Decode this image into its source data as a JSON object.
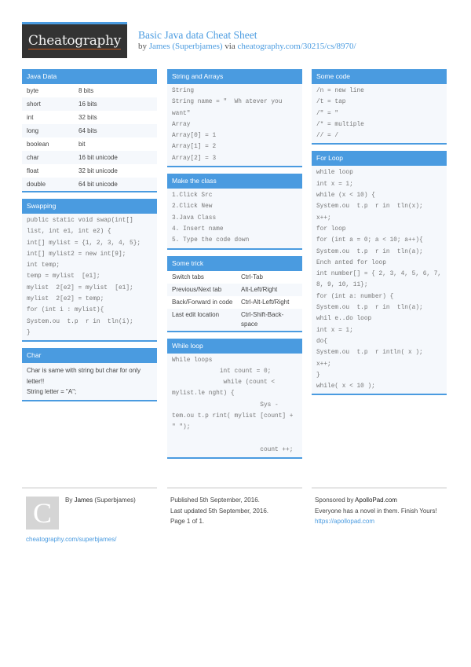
{
  "header": {
    "logo_text": "Cheatography",
    "title": "Basic Java data Cheat Sheet",
    "by_prefix": "by ",
    "author": "James (Superbjames)",
    "via": " via ",
    "url": "cheatography.com/30215/cs/8970/"
  },
  "colors": {
    "accent": "#4a9be0",
    "logo_bg": "#333333",
    "logo_underline": "#c0571c"
  },
  "java_data": {
    "title": "Java Data",
    "rows": [
      {
        "k": "byte",
        "v": "8 bits"
      },
      {
        "k": "short",
        "v": "16 bits"
      },
      {
        "k": "int",
        "v": "32 bits"
      },
      {
        "k": "long",
        "v": "64 bits"
      },
      {
        "k": "boolean",
        "v": "bit"
      },
      {
        "k": "char",
        "v": "16 bit unicode"
      },
      {
        "k": "float",
        "v": "32 bit unicode"
      },
      {
        "k": "double",
        "v": "64 bit unicode"
      }
    ]
  },
  "swapping": {
    "title": "Swapping",
    "lines": [
      "public static void swap(int[] list, int e1, int e2) {",
      "int[] mylist = {1, 2, 3, 4, 5};",
      "int[] mylist2 = new int[9];",
      "int temp;",
      "temp = mylist  [e1];",
      "mylist  2[e2] = mylist  [e1];",
      "mylist  2[e2] = temp;",
      "for (int i : mylist){",
      "System.ou  t.p  r in  tln(i);",
      "}"
    ]
  },
  "char": {
    "title": "Char",
    "lines": [
      "Char is same with string but char for only letter!!",
      "String letter = \"A\";"
    ]
  },
  "strings": {
    "title": "String and Arrays",
    "lines": [
      "String",
      "String name = \"  Wh atever you want\"",
      "Array",
      "Array[0] = 1",
      "Array[1] = 2",
      "Array[2] = 3"
    ]
  },
  "make_class": {
    "title": "Make the class",
    "lines": [
      "1.Click Src",
      "2.Click New",
      "3.Java Class",
      "4. Insert name",
      "5. Type the code down"
    ]
  },
  "some_trick": {
    "title": "Some trick",
    "rows": [
      {
        "k": "Switch tabs",
        "v": "Ctrl-Tab"
      },
      {
        "k": "Previous/Next tab",
        "v": "Alt-Left/Right"
      },
      {
        "k": "Back/Forward in code",
        "v": "Ctrl-Alt-Left/Right"
      },
      {
        "k": "Last edit location",
        "v": "Ctrl-Shift-Back-space"
      }
    ]
  },
  "while_loop": {
    "title": "While loop",
    "lines": [
      "While loops",
      "             int count = 0;",
      "              while (count < mylist.le nght) {",
      "                        Sys - tem.ou t.p rint( mylist [count] + \" \");",
      "",
      "                        count ++;"
    ]
  },
  "some_code": {
    "title": "Some code",
    "lines": [
      "/n = new line",
      "/t = tap",
      "/\" = \"",
      "/* = multiple",
      "// = /"
    ]
  },
  "for_loop": {
    "title": "For Loop",
    "lines": [
      "while loop",
      "int x = 1;",
      "while (x < 10) {",
      "System.ou  t.p  r in  tln(x);",
      "x++;",
      "for loop",
      "for (int a = 0; a < 10; a++){",
      "System.ou  t.p  r in  tln(a);",
      "Ench anted for loop",
      "int number[] = { 2, 3, 4, 5, 6, 7, 8, 9, 10, 11};",
      "for (int a: number) {",
      "System.ou  t.p  r in  tln(a);",
      "whil e..do loop",
      "int x = 1;",
      "do{",
      "System.ou  t.p  r intln( x );",
      "x++;",
      "}",
      "while( x < 10 );"
    ]
  },
  "footer": {
    "avatar_letter": "C",
    "by_prefix": "By ",
    "author_name": "James",
    "author_handle": " (Superbjames)",
    "author_url": "cheatography.com/superbjames/",
    "published": "Published 5th September, 2016.",
    "updated": "Last updated 5th September, 2016.",
    "page": "Page 1 of 1.",
    "sponsor_prefix": "Sponsored by ",
    "sponsor_name": "ApolloPad.com",
    "sponsor_text": "Everyone has a novel in them. Finish Yours!",
    "sponsor_url": "https://apollopad.com"
  }
}
